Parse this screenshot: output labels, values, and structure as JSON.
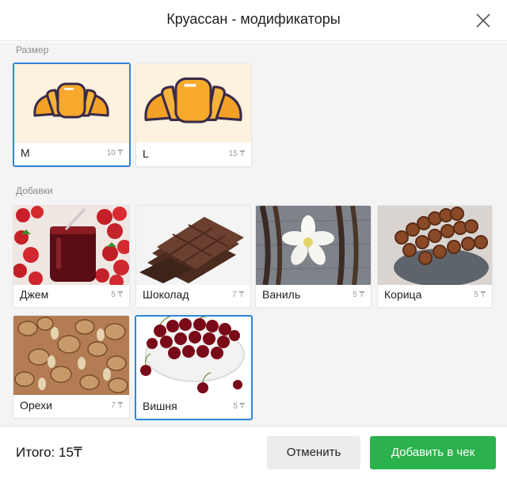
{
  "dialog": {
    "title": "Круассан - модификаторы"
  },
  "sections": {
    "size": {
      "label": "Размер"
    },
    "additions": {
      "label": "Добавки"
    }
  },
  "sizes": [
    {
      "name": "M",
      "price": "10 ₸",
      "selected": true
    },
    {
      "name": "L",
      "price": "15 ₸",
      "selected": false
    }
  ],
  "additions": [
    {
      "name": "Джем",
      "price": "5 ₸",
      "selected": false
    },
    {
      "name": "Шоколад",
      "price": "7 ₸",
      "selected": false
    },
    {
      "name": "Ваниль",
      "price": "5 ₸",
      "selected": false
    },
    {
      "name": "Корица",
      "price": "5 ₸",
      "selected": false
    },
    {
      "name": "Орехи",
      "price": "7 ₸",
      "selected": false
    },
    {
      "name": "Вишня",
      "price": "5 ₸",
      "selected": true
    }
  ],
  "footer": {
    "total": "Итого: 15₸",
    "cancel_label": "Отменить",
    "add_label": "Добавить в чек"
  },
  "colors": {
    "accent": "#2f86d8",
    "primary_button": "#2bb24c"
  }
}
